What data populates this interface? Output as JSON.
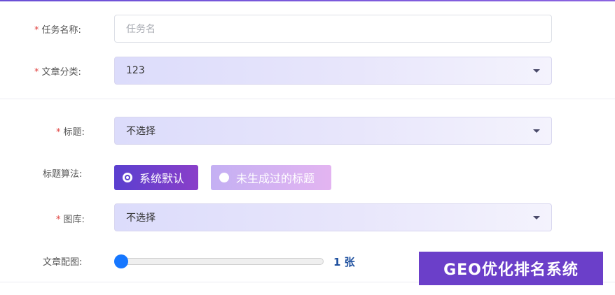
{
  "form": {
    "task_name": {
      "label": "任务名称:",
      "required": true,
      "placeholder": "任务名",
      "value": ""
    },
    "article_category": {
      "label": "文章分类:",
      "required": true,
      "value": "123"
    },
    "title": {
      "label": "标题:",
      "required": true,
      "value": "不选择"
    },
    "title_algorithm": {
      "label": "标题算法:",
      "options": [
        "系统默认",
        "未生成过的标题"
      ],
      "selected": "系统默认"
    },
    "gallery": {
      "label": "图库:",
      "required": true,
      "value": "不选择"
    },
    "article_images": {
      "label": "文章配图:",
      "value": 1,
      "value_text": "1 张"
    }
  },
  "brand": {
    "text": "GEO优化排名系统"
  },
  "colors": {
    "required_mark": "#e0413f",
    "accent": "#6b3fc9",
    "slider": "#1677ff"
  }
}
